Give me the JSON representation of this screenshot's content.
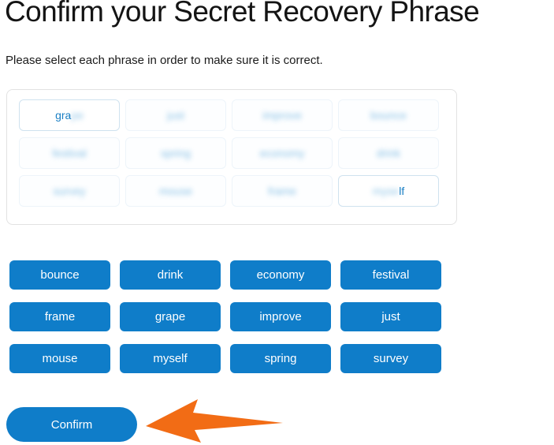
{
  "page": {
    "title": "Confirm your Secret Recovery Phrase",
    "subtitle": "Please select each phrase in order to make sure it is correct."
  },
  "phrase_grid": {
    "rows": 3,
    "columns": 4,
    "cells": [
      {
        "index": 1,
        "text": "grape",
        "revealed": "partial",
        "clear_prefix": "gra",
        "blurred_suffix": "pe",
        "selected": true
      },
      {
        "index": 2,
        "text": "just",
        "revealed": "blurred",
        "selected": false
      },
      {
        "index": 3,
        "text": "improve",
        "revealed": "blurred",
        "selected": false
      },
      {
        "index": 4,
        "text": "bounce",
        "revealed": "blurred",
        "selected": false
      },
      {
        "index": 5,
        "text": "festival",
        "revealed": "blurred",
        "selected": false
      },
      {
        "index": 6,
        "text": "spring",
        "revealed": "blurred",
        "selected": false
      },
      {
        "index": 7,
        "text": "economy",
        "revealed": "blurred",
        "selected": false
      },
      {
        "index": 8,
        "text": "drink",
        "revealed": "blurred",
        "selected": false
      },
      {
        "index": 9,
        "text": "survey",
        "revealed": "blurred",
        "selected": false
      },
      {
        "index": 10,
        "text": "mouse",
        "revealed": "blurred",
        "selected": false
      },
      {
        "index": 11,
        "text": "frame",
        "revealed": "blurred",
        "selected": false
      },
      {
        "index": 12,
        "text": "myself",
        "revealed": "partial",
        "blurred_prefix": "myse",
        "clear_suffix": "lf",
        "selected": true
      }
    ]
  },
  "word_bank": {
    "words": [
      "bounce",
      "drink",
      "economy",
      "festival",
      "frame",
      "grape",
      "improve",
      "just",
      "mouse",
      "myself",
      "spring",
      "survey"
    ]
  },
  "actions": {
    "confirm_label": "Confirm"
  },
  "annotation": {
    "arrow": "left-pointing-arrow",
    "points_to": "Confirm"
  },
  "colors": {
    "primary_blue": "#0f7dc9",
    "phrase_text_blue": "#1a7fc4",
    "annotation_orange": "#f26c15",
    "panel_border": "#e2e2e2",
    "cell_border": "#cfe2ef",
    "text_dark": "#141414"
  }
}
